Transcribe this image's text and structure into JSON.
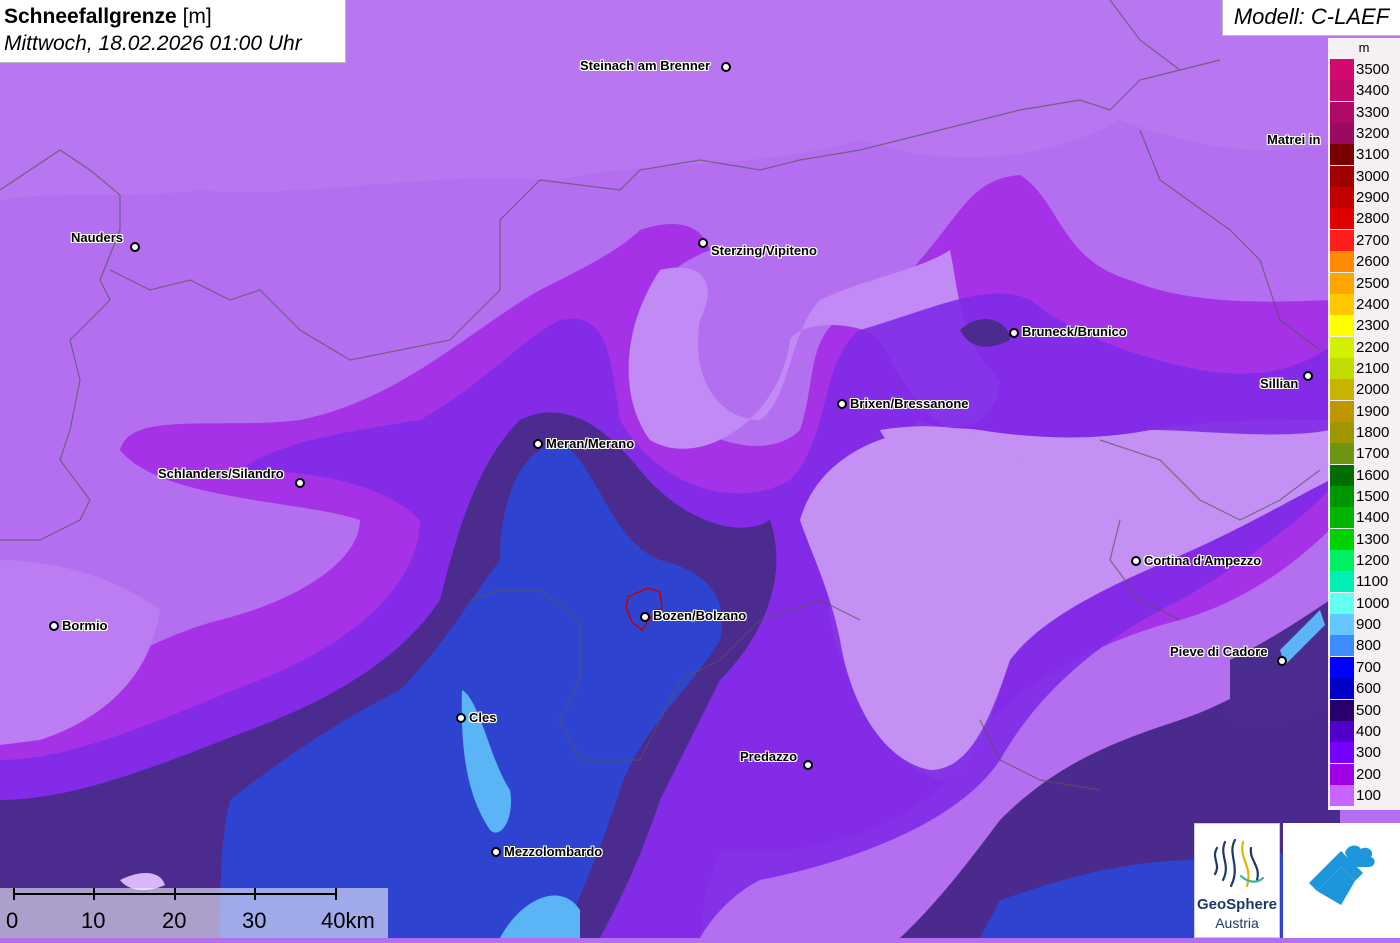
{
  "header": {
    "title": "Schneefallgrenze",
    "unit": "[m]",
    "datetime": "Mittwoch, 18.02.2026 01:00 Uhr",
    "model": "Modell: C-LAEF"
  },
  "legend": {
    "unit": "m",
    "levels": [
      {
        "value": "3500",
        "color": "#d20a6e"
      },
      {
        "value": "3400",
        "color": "#c40a6c"
      },
      {
        "value": "3300",
        "color": "#b00a68"
      },
      {
        "value": "3200",
        "color": "#9a0a60"
      },
      {
        "value": "3100",
        "color": "#7a0000"
      },
      {
        "value": "3000",
        "color": "#a00000"
      },
      {
        "value": "2900",
        "color": "#c40000"
      },
      {
        "value": "2800",
        "color": "#e00000"
      },
      {
        "value": "2700",
        "color": "#ff1e1e"
      },
      {
        "value": "2600",
        "color": "#ff8c00"
      },
      {
        "value": "2500",
        "color": "#ffa500"
      },
      {
        "value": "2400",
        "color": "#ffc800"
      },
      {
        "value": "2300",
        "color": "#ffff00"
      },
      {
        "value": "2200",
        "color": "#d2f000"
      },
      {
        "value": "2100",
        "color": "#c0dc00"
      },
      {
        "value": "2000",
        "color": "#c8b400"
      },
      {
        "value": "1900",
        "color": "#c09600"
      },
      {
        "value": "1800",
        "color": "#a09600"
      },
      {
        "value": "1700",
        "color": "#6e9614"
      },
      {
        "value": "1600",
        "color": "#006e00"
      },
      {
        "value": "1500",
        "color": "#009600"
      },
      {
        "value": "1400",
        "color": "#00b400"
      },
      {
        "value": "1300",
        "color": "#00d200"
      },
      {
        "value": "1200",
        "color": "#00f064"
      },
      {
        "value": "1100",
        "color": "#00f0b4"
      },
      {
        "value": "1000",
        "color": "#64fff0"
      },
      {
        "value": "900",
        "color": "#64c8ff"
      },
      {
        "value": "800",
        "color": "#3c8cff"
      },
      {
        "value": "700",
        "color": "#0000ff"
      },
      {
        "value": "600",
        "color": "#0000c8"
      },
      {
        "value": "500",
        "color": "#28006e"
      },
      {
        "value": "400",
        "color": "#5000c8"
      },
      {
        "value": "300",
        "color": "#7800ff"
      },
      {
        "value": "200",
        "color": "#a000e6"
      },
      {
        "value": "100",
        "color": "#c864ff"
      }
    ]
  },
  "cities": [
    {
      "name": "Steinach am Brenner",
      "label": "Steinach am Brenner"
    },
    {
      "name": "Matrei",
      "label": "Matrei in"
    },
    {
      "name": "Nauders",
      "label": "Nauders"
    },
    {
      "name": "Sterzing",
      "label": "Sterzing/Vipiteno"
    },
    {
      "name": "Bruneck",
      "label": "Bruneck/Brunico"
    },
    {
      "name": "Sillian",
      "label": "Sillian"
    },
    {
      "name": "Brixen",
      "label": "Brixen/Bressanone"
    },
    {
      "name": "Meran",
      "label": "Meran/Merano"
    },
    {
      "name": "Schlanders",
      "label": "Schlanders/Silandro"
    },
    {
      "name": "Cortina",
      "label": "Cortina d'Ampezzo"
    },
    {
      "name": "Bormio",
      "label": "Bormio"
    },
    {
      "name": "Bozen",
      "label": "Bozen/Bolzano"
    },
    {
      "name": "Pieve",
      "label": "Pieve di Cadore"
    },
    {
      "name": "Cles",
      "label": "Cles"
    },
    {
      "name": "Predazzo",
      "label": "Predazzo"
    },
    {
      "name": "Mezzolombardo",
      "label": "Mezzolombardo"
    }
  ],
  "scale": {
    "ticks": [
      "0",
      "10",
      "20",
      "30",
      "40km"
    ]
  },
  "logos": {
    "geosphere_name": "GeoSphere",
    "geosphere_sub": "Austria"
  },
  "colors": {
    "base": "#b46ef0",
    "light_zone": "#c896f5",
    "band_200": "#a032e6",
    "band_300": "#7d28e6",
    "band_dark": "#4b2896",
    "band_blue": "#2d46d2",
    "band_lightblue": "#5ab4f5"
  }
}
